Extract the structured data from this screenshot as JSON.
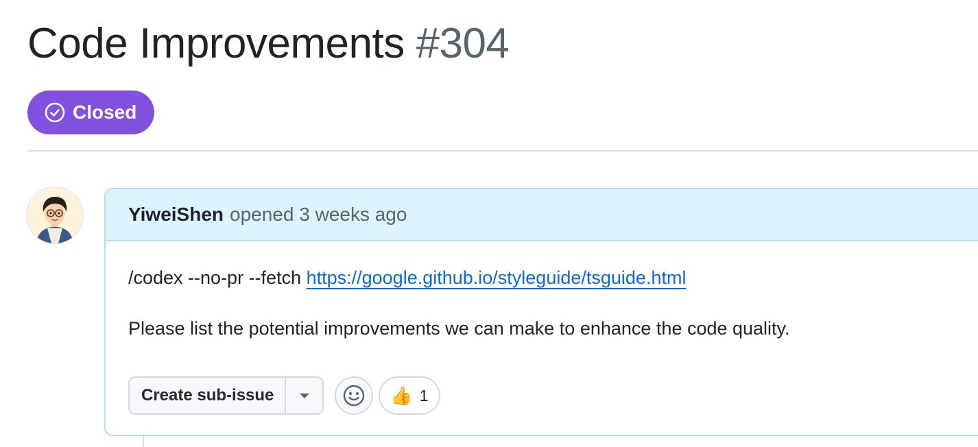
{
  "issue": {
    "title": "Code Improvements",
    "number": "#304",
    "state": "Closed",
    "state_icon": "check-circle-icon"
  },
  "comment": {
    "author": "YiweiShen",
    "meta": "opened 3 weeks ago",
    "command_text": "/codex --no-pr --fetch ",
    "link_text": "https://google.github.io/styleguide/tsguide.html",
    "body_text": "Please list the potential improvements we can make to enhance the code quality."
  },
  "actions": {
    "create_sub_issue": "Create sub-issue",
    "caret_icon": "triangle-down-icon",
    "emoji_icon": "smiley-icon"
  },
  "reactions": [
    {
      "emoji": "👍",
      "count": "1"
    }
  ],
  "colors": {
    "closed_badge": "#8250df",
    "link": "#0969da",
    "header_bg": "#ddf4ff",
    "header_border": "#b6dcf5"
  }
}
